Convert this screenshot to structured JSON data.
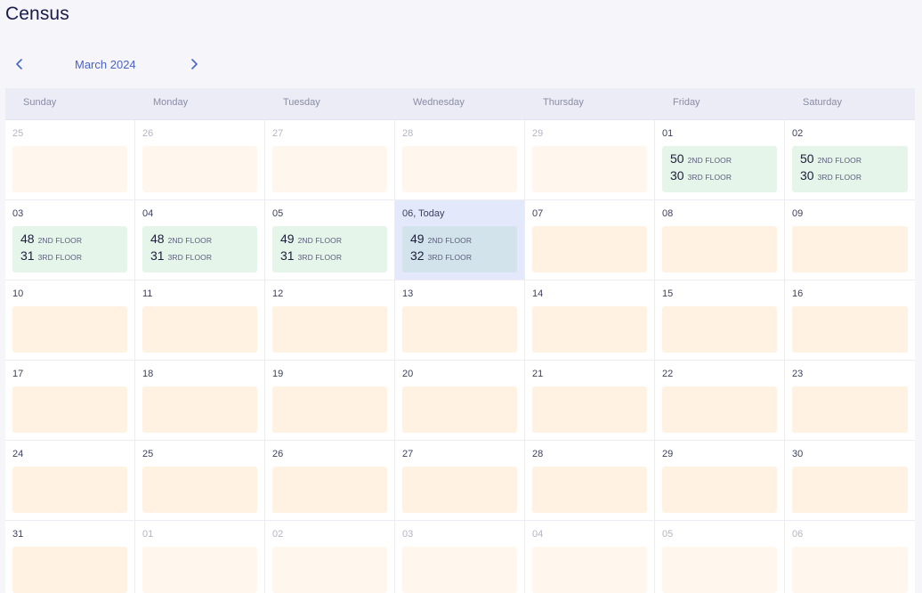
{
  "page_title": "Census",
  "nav": {
    "month_label": "March 2024",
    "prev_icon": "chevron-left-icon",
    "next_icon": "chevron-right-icon",
    "accent": "#4a63c9"
  },
  "weekdays": [
    "Sunday",
    "Monday",
    "Tuesday",
    "Wednesday",
    "Thursday",
    "Friday",
    "Saturday"
  ],
  "floor_labels": {
    "second": "2ND FLOOR",
    "third": "3RD FLOOR"
  },
  "colors": {
    "empty_cell": "#fff2e3",
    "filled_cell": "#e5f5ea",
    "today_cell": "#d2e3ec",
    "today_bg": "#e3e8fb"
  },
  "days": [
    {
      "label": "25",
      "muted": true
    },
    {
      "label": "26",
      "muted": true
    },
    {
      "label": "27",
      "muted": true
    },
    {
      "label": "28",
      "muted": true
    },
    {
      "label": "29",
      "muted": true
    },
    {
      "label": "01",
      "second": "50",
      "third": "30"
    },
    {
      "label": "02",
      "second": "50",
      "third": "30"
    },
    {
      "label": "03",
      "second": "48",
      "third": "31"
    },
    {
      "label": "04",
      "second": "48",
      "third": "31"
    },
    {
      "label": "05",
      "second": "49",
      "third": "31"
    },
    {
      "label": "06, Today",
      "today": true,
      "second": "49",
      "third": "32"
    },
    {
      "label": "07"
    },
    {
      "label": "08"
    },
    {
      "label": "09"
    },
    {
      "label": "10"
    },
    {
      "label": "11"
    },
    {
      "label": "12"
    },
    {
      "label": "13"
    },
    {
      "label": "14"
    },
    {
      "label": "15"
    },
    {
      "label": "16"
    },
    {
      "label": "17"
    },
    {
      "label": "18"
    },
    {
      "label": "19"
    },
    {
      "label": "20"
    },
    {
      "label": "21"
    },
    {
      "label": "22"
    },
    {
      "label": "23"
    },
    {
      "label": "24"
    },
    {
      "label": "25"
    },
    {
      "label": "26"
    },
    {
      "label": "27"
    },
    {
      "label": "28"
    },
    {
      "label": "29"
    },
    {
      "label": "30"
    },
    {
      "label": "31"
    },
    {
      "label": "01",
      "muted": true
    },
    {
      "label": "02",
      "muted": true
    },
    {
      "label": "03",
      "muted": true
    },
    {
      "label": "04",
      "muted": true
    },
    {
      "label": "05",
      "muted": true
    },
    {
      "label": "06",
      "muted": true
    }
  ]
}
